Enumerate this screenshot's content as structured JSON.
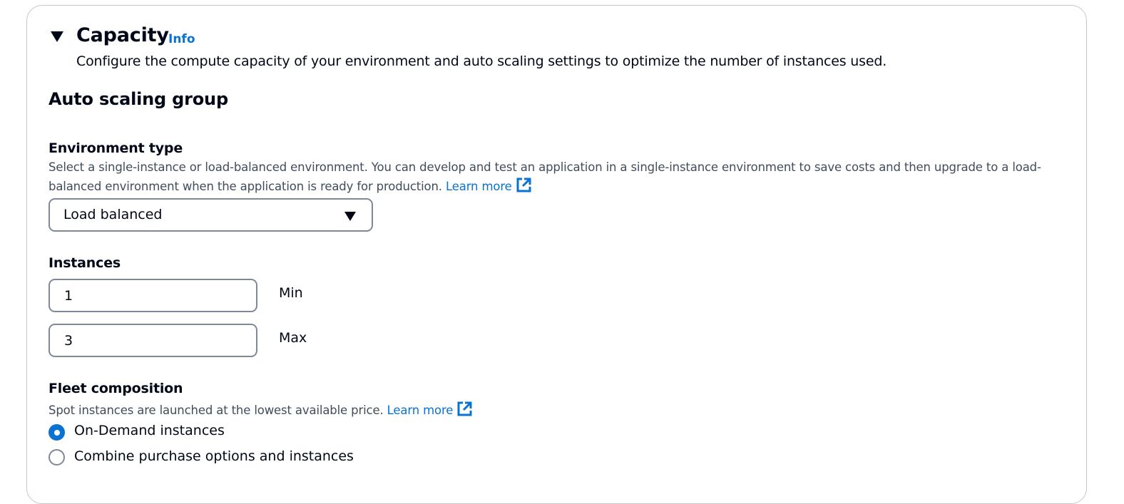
{
  "capacity": {
    "title": "Capacity",
    "info_link": "Info",
    "description": "Configure the compute capacity of your environment and auto scaling settings to optimize the number of instances used."
  },
  "auto_scaling": {
    "heading": "Auto scaling group",
    "environment_type": {
      "label": "Environment type",
      "help_line1": "Select a single-instance or load-balanced environment. You can develop and test an application in a single-instance environment to save costs and then upgrade to a load-",
      "help_line2": "balanced environment when the application is ready for production.",
      "learn_more": "Learn more",
      "selected_value": "Load balanced"
    },
    "instances": {
      "label": "Instances",
      "min_value": "1",
      "min_label": "Min",
      "max_value": "3",
      "max_label": "Max"
    },
    "fleet_composition": {
      "label": "Fleet composition",
      "help": "Spot instances are launched at the lowest available price.",
      "learn_more": "Learn more",
      "options": [
        {
          "label": "On-Demand instances",
          "checked": true
        },
        {
          "label": "Combine purchase options and instances",
          "checked": false
        }
      ]
    }
  },
  "colors": {
    "link": "#0972d3",
    "text": "#000716",
    "help_text": "#414d5c",
    "border": "#7d8998"
  }
}
